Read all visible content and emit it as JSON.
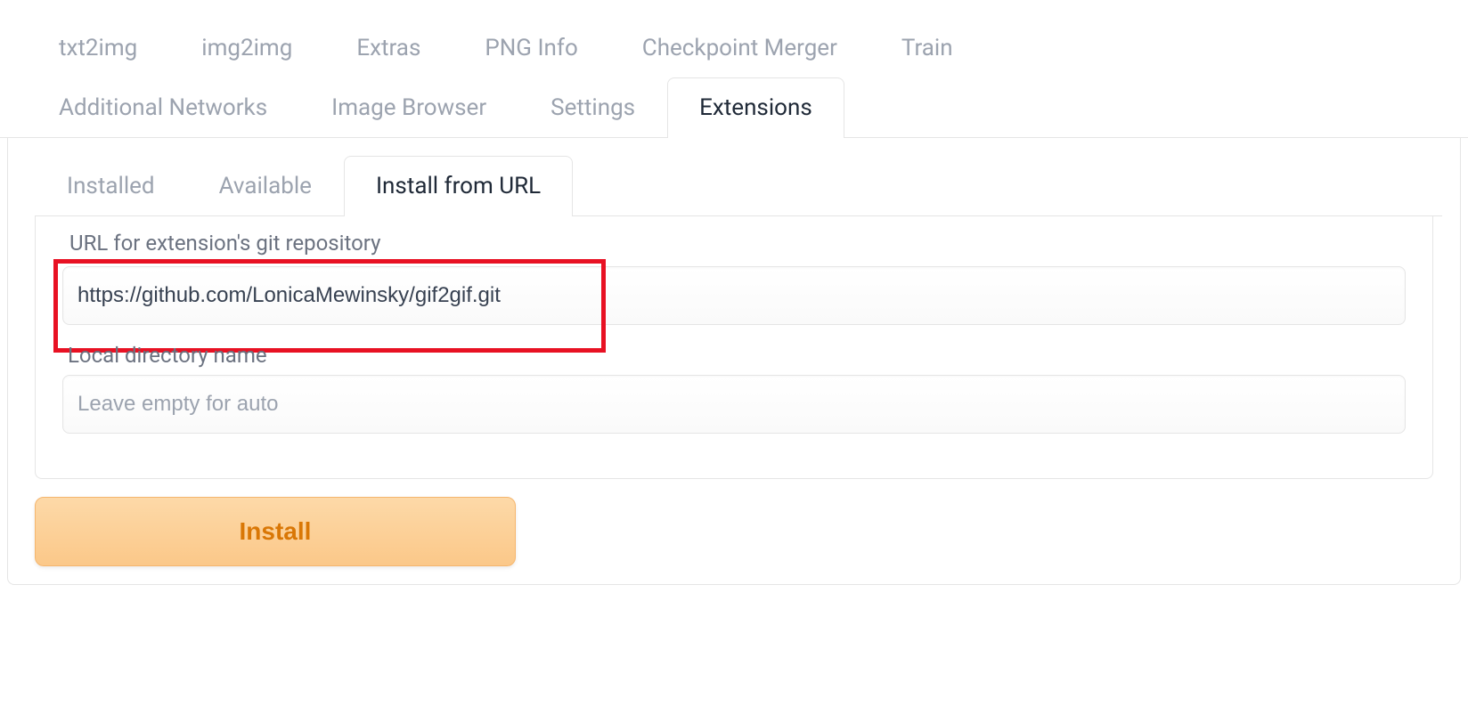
{
  "main_tabs": {
    "txt2img": "txt2img",
    "img2img": "img2img",
    "extras": "Extras",
    "png_info": "PNG Info",
    "checkpoint_merger": "Checkpoint Merger",
    "train": "Train",
    "additional_networks": "Additional Networks",
    "image_browser": "Image Browser",
    "settings": "Settings",
    "extensions": "Extensions"
  },
  "sub_tabs": {
    "installed": "Installed",
    "available": "Available",
    "install_from_url": "Install from URL"
  },
  "form": {
    "url_label": "URL for extension's git repository",
    "url_value": "https://github.com/LonicaMewinsky/gif2gif.git",
    "dir_label": "Local directory name",
    "dir_placeholder": "Leave empty for auto",
    "dir_value": "",
    "install_button": "Install"
  },
  "colors": {
    "accent": "#d97706",
    "highlight": "#e81123"
  }
}
